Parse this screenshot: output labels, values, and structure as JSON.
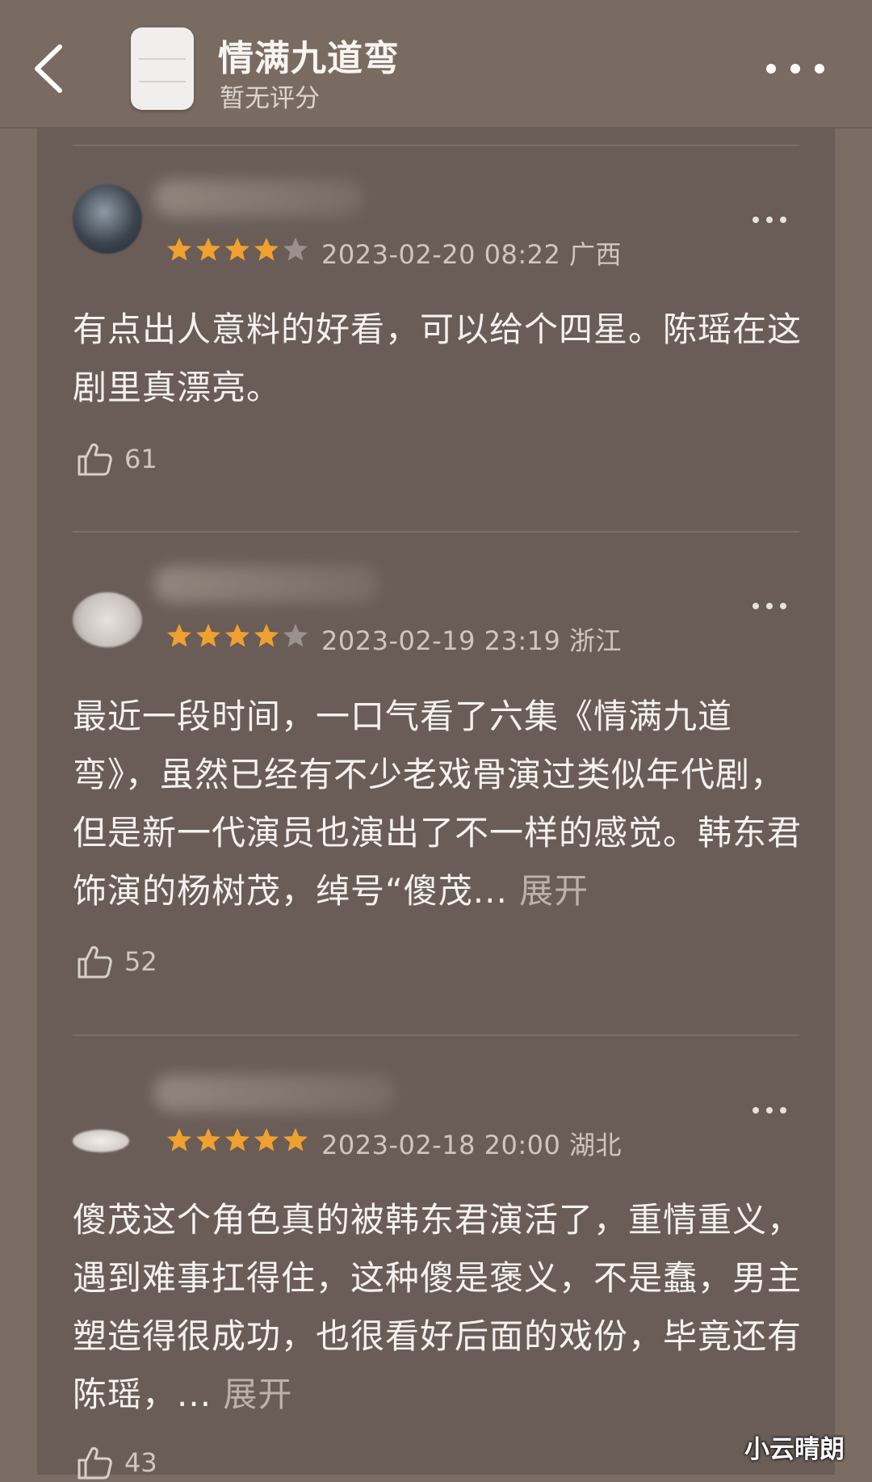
{
  "header": {
    "title": "情满九道弯",
    "subtitle": "暂无评分",
    "back_icon": "chevron-left-icon",
    "more_icon": "more-horizontal-icon"
  },
  "reviews": [
    {
      "rating": 4,
      "date": "2023-02-20 08:22",
      "location": "广西",
      "text": "有点出人意料的好看，可以给个四星。陈瑶在这剧里真漂亮。",
      "expand_label": "",
      "likes": "61"
    },
    {
      "rating": 4,
      "date": "2023-02-19 23:19",
      "location": "浙江",
      "text": "最近一段时间，一口气看了六集《情满九道弯》，虽然已经有不少老戏骨演过类似年代剧，但是新一代演员也演出了不一样的感觉。韩东君饰演的杨树茂，绰号“傻茂...",
      "expand_label": " 展开",
      "likes": "52"
    },
    {
      "rating": 5,
      "date": "2023-02-18 20:00",
      "location": "湖北",
      "text": "傻茂这个角色真的被韩东君演活了，重情重义，遇到难事扛得住，这种傻是褒义，不是蠢，男主塑造得很成功，也很看好后面的戏份，毕竟还有陈瑶，...",
      "expand_label": " 展开",
      "likes": "43"
    }
  ],
  "watermark": "小云晴朗",
  "colors": {
    "background": "#7b6c64",
    "panel": "#6a5d58",
    "star_on": "#f0a02e",
    "star_off": "#9a918c"
  }
}
